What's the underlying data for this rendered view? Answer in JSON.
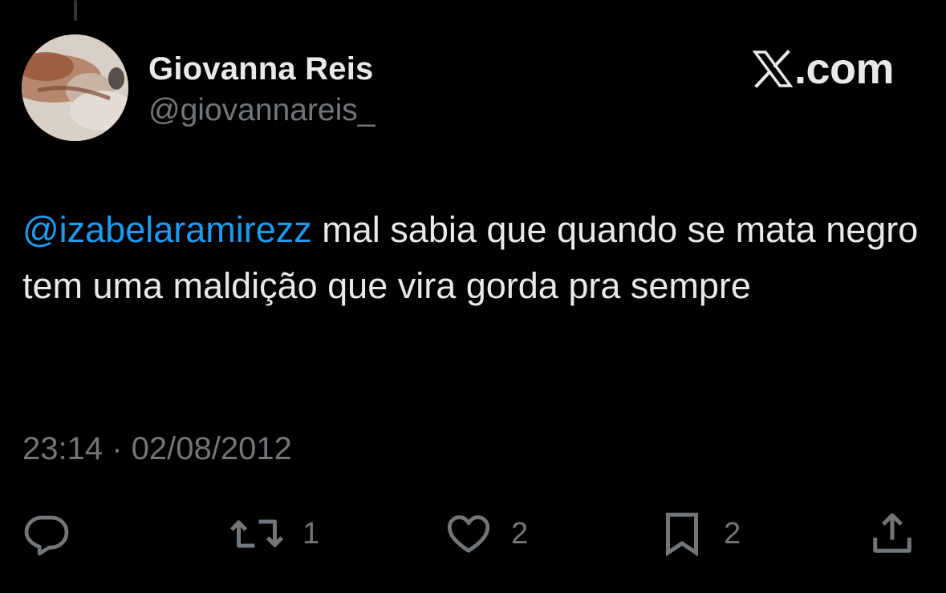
{
  "tweet": {
    "display_name": "Giovanna Reis",
    "handle": "@giovannareis_",
    "brand": "X.com",
    "brand_x": "X",
    "brand_suffix": ".com",
    "mention": "@izabelaramirezz",
    "text": " mal sabia que quando se mata negro tem uma maldição que vira gorda pra sempre",
    "timestamp": "23:14 · 02/08/2012"
  },
  "actions": {
    "reply": {
      "icon": "reply-icon",
      "count": ""
    },
    "retweet": {
      "icon": "retweet-icon",
      "count": "1"
    },
    "like": {
      "icon": "heart-icon",
      "count": "2"
    },
    "bookmark": {
      "icon": "bookmark-icon",
      "count": "2"
    },
    "share": {
      "icon": "share-icon",
      "count": ""
    }
  },
  "colors": {
    "background": "#000000",
    "text_primary": "#e7e9ea",
    "text_secondary": "#71767b",
    "mention": "#1d9bf0"
  }
}
